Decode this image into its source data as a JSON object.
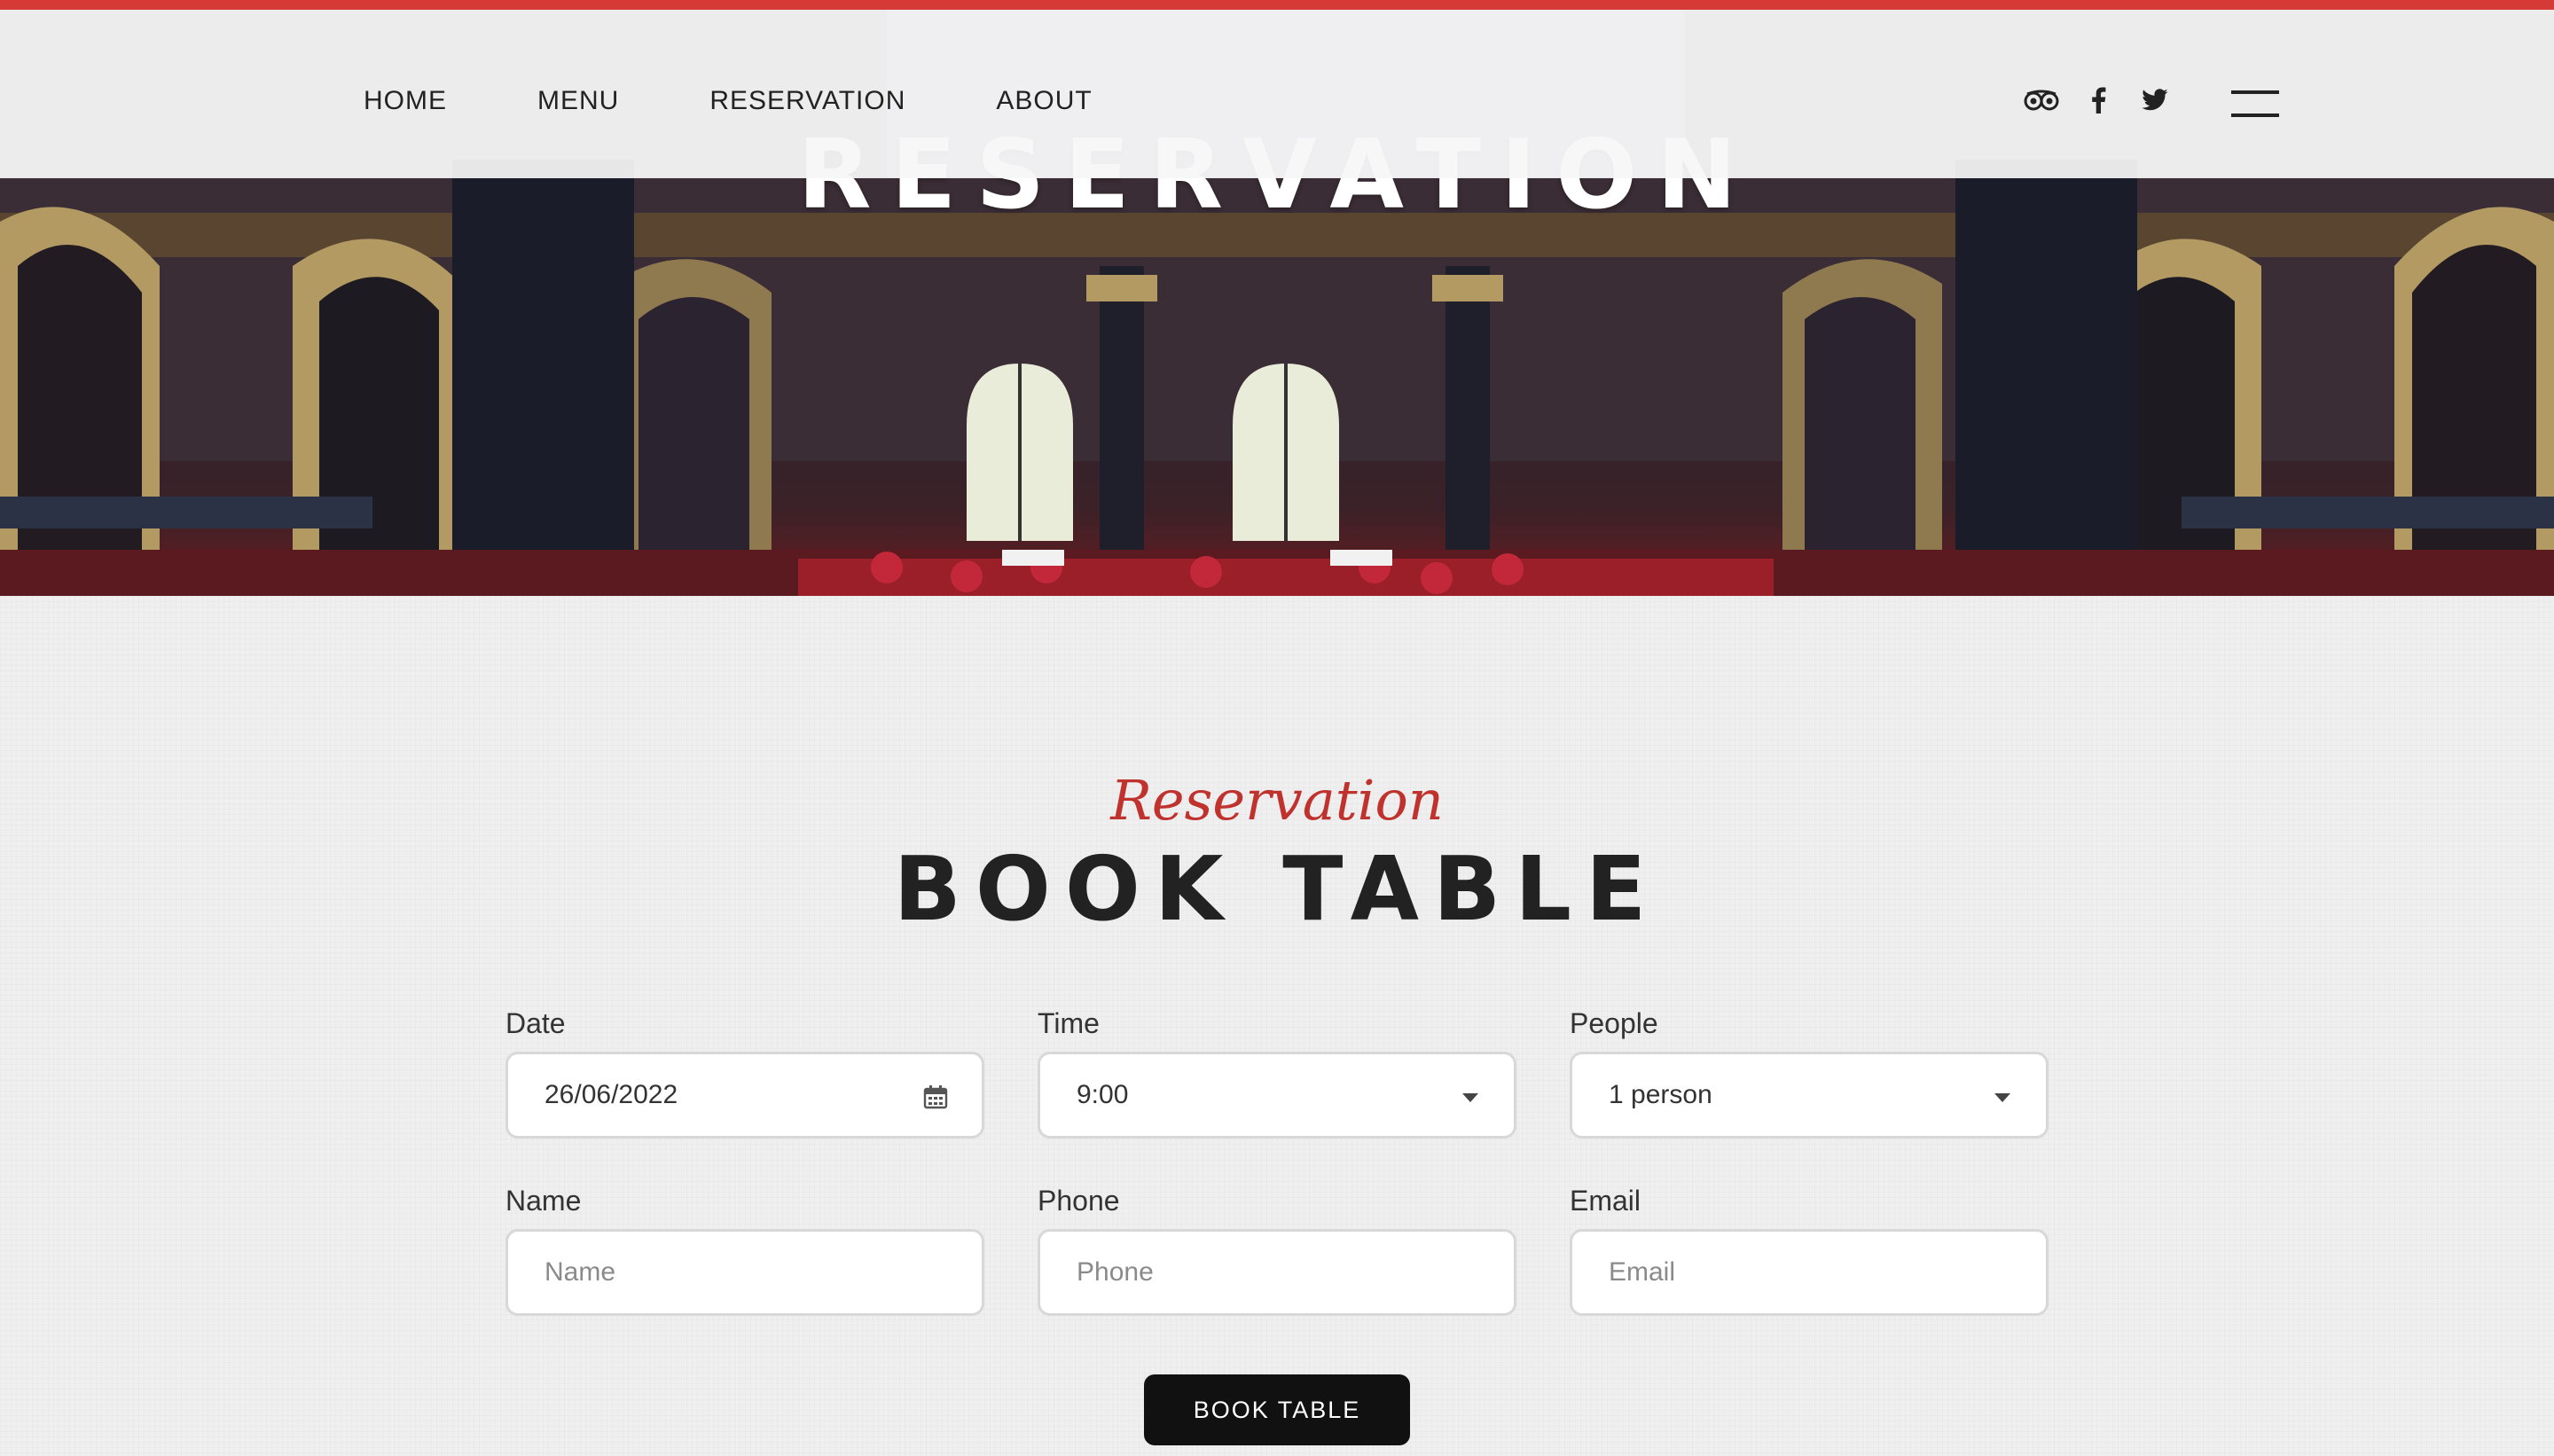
{
  "nav": {
    "links": [
      "HOME",
      "MENU",
      "RESERVATION",
      "ABOUT"
    ],
    "social_icons": [
      "tripadvisor-icon",
      "facebook-icon",
      "twitter-icon"
    ],
    "menu_icon": "hamburger-icon"
  },
  "hero": {
    "title": "RESERVATION"
  },
  "section": {
    "subtitle": "Reservation",
    "title": "BOOK TABLE"
  },
  "form": {
    "date": {
      "label": "Date",
      "value": "26/06/2022",
      "icon": "calendar-icon"
    },
    "time": {
      "label": "Time",
      "value": "9:00",
      "icon": "chevron-down-icon"
    },
    "people": {
      "label": "People",
      "value": "1 person",
      "icon": "chevron-down-icon"
    },
    "name": {
      "label": "Name",
      "placeholder": "Name"
    },
    "phone": {
      "label": "Phone",
      "placeholder": "Phone"
    },
    "email": {
      "label": "Email",
      "placeholder": "Email"
    },
    "submit_label": "BOOK TABLE"
  },
  "colors": {
    "accent": "#d63a36",
    "subtitle": "#c0322e",
    "button": "#111111",
    "page_bg": "#efefef"
  }
}
